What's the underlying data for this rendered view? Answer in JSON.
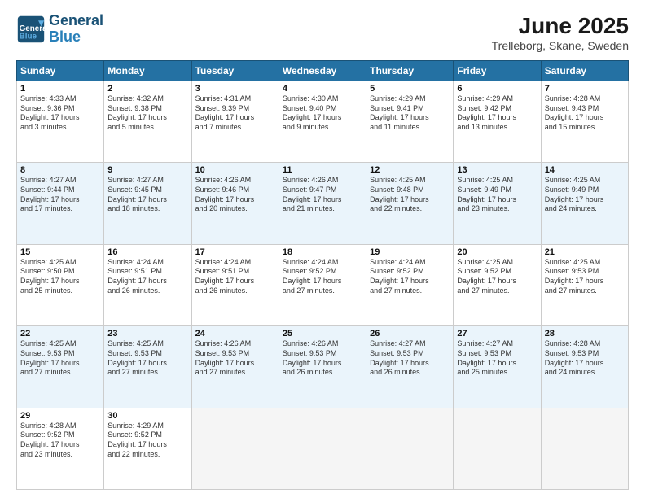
{
  "header": {
    "logo_line1": "General",
    "logo_line2": "Blue",
    "month": "June 2025",
    "location": "Trelleborg, Skane, Sweden"
  },
  "weekdays": [
    "Sunday",
    "Monday",
    "Tuesday",
    "Wednesday",
    "Thursday",
    "Friday",
    "Saturday"
  ],
  "weeks": [
    [
      {
        "day": "1",
        "info": "Sunrise: 4:33 AM\nSunset: 9:36 PM\nDaylight: 17 hours\nand 3 minutes."
      },
      {
        "day": "2",
        "info": "Sunrise: 4:32 AM\nSunset: 9:38 PM\nDaylight: 17 hours\nand 5 minutes."
      },
      {
        "day": "3",
        "info": "Sunrise: 4:31 AM\nSunset: 9:39 PM\nDaylight: 17 hours\nand 7 minutes."
      },
      {
        "day": "4",
        "info": "Sunrise: 4:30 AM\nSunset: 9:40 PM\nDaylight: 17 hours\nand 9 minutes."
      },
      {
        "day": "5",
        "info": "Sunrise: 4:29 AM\nSunset: 9:41 PM\nDaylight: 17 hours\nand 11 minutes."
      },
      {
        "day": "6",
        "info": "Sunrise: 4:29 AM\nSunset: 9:42 PM\nDaylight: 17 hours\nand 13 minutes."
      },
      {
        "day": "7",
        "info": "Sunrise: 4:28 AM\nSunset: 9:43 PM\nDaylight: 17 hours\nand 15 minutes."
      }
    ],
    [
      {
        "day": "8",
        "info": "Sunrise: 4:27 AM\nSunset: 9:44 PM\nDaylight: 17 hours\nand 17 minutes."
      },
      {
        "day": "9",
        "info": "Sunrise: 4:27 AM\nSunset: 9:45 PM\nDaylight: 17 hours\nand 18 minutes."
      },
      {
        "day": "10",
        "info": "Sunrise: 4:26 AM\nSunset: 9:46 PM\nDaylight: 17 hours\nand 20 minutes."
      },
      {
        "day": "11",
        "info": "Sunrise: 4:26 AM\nSunset: 9:47 PM\nDaylight: 17 hours\nand 21 minutes."
      },
      {
        "day": "12",
        "info": "Sunrise: 4:25 AM\nSunset: 9:48 PM\nDaylight: 17 hours\nand 22 minutes."
      },
      {
        "day": "13",
        "info": "Sunrise: 4:25 AM\nSunset: 9:49 PM\nDaylight: 17 hours\nand 23 minutes."
      },
      {
        "day": "14",
        "info": "Sunrise: 4:25 AM\nSunset: 9:49 PM\nDaylight: 17 hours\nand 24 minutes."
      }
    ],
    [
      {
        "day": "15",
        "info": "Sunrise: 4:25 AM\nSunset: 9:50 PM\nDaylight: 17 hours\nand 25 minutes."
      },
      {
        "day": "16",
        "info": "Sunrise: 4:24 AM\nSunset: 9:51 PM\nDaylight: 17 hours\nand 26 minutes."
      },
      {
        "day": "17",
        "info": "Sunrise: 4:24 AM\nSunset: 9:51 PM\nDaylight: 17 hours\nand 26 minutes."
      },
      {
        "day": "18",
        "info": "Sunrise: 4:24 AM\nSunset: 9:52 PM\nDaylight: 17 hours\nand 27 minutes."
      },
      {
        "day": "19",
        "info": "Sunrise: 4:24 AM\nSunset: 9:52 PM\nDaylight: 17 hours\nand 27 minutes."
      },
      {
        "day": "20",
        "info": "Sunrise: 4:25 AM\nSunset: 9:52 PM\nDaylight: 17 hours\nand 27 minutes."
      },
      {
        "day": "21",
        "info": "Sunrise: 4:25 AM\nSunset: 9:53 PM\nDaylight: 17 hours\nand 27 minutes."
      }
    ],
    [
      {
        "day": "22",
        "info": "Sunrise: 4:25 AM\nSunset: 9:53 PM\nDaylight: 17 hours\nand 27 minutes."
      },
      {
        "day": "23",
        "info": "Sunrise: 4:25 AM\nSunset: 9:53 PM\nDaylight: 17 hours\nand 27 minutes."
      },
      {
        "day": "24",
        "info": "Sunrise: 4:26 AM\nSunset: 9:53 PM\nDaylight: 17 hours\nand 27 minutes."
      },
      {
        "day": "25",
        "info": "Sunrise: 4:26 AM\nSunset: 9:53 PM\nDaylight: 17 hours\nand 26 minutes."
      },
      {
        "day": "26",
        "info": "Sunrise: 4:27 AM\nSunset: 9:53 PM\nDaylight: 17 hours\nand 26 minutes."
      },
      {
        "day": "27",
        "info": "Sunrise: 4:27 AM\nSunset: 9:53 PM\nDaylight: 17 hours\nand 25 minutes."
      },
      {
        "day": "28",
        "info": "Sunrise: 4:28 AM\nSunset: 9:53 PM\nDaylight: 17 hours\nand 24 minutes."
      }
    ],
    [
      {
        "day": "29",
        "info": "Sunrise: 4:28 AM\nSunset: 9:52 PM\nDaylight: 17 hours\nand 23 minutes."
      },
      {
        "day": "30",
        "info": "Sunrise: 4:29 AM\nSunset: 9:52 PM\nDaylight: 17 hours\nand 22 minutes."
      },
      null,
      null,
      null,
      null,
      null
    ]
  ]
}
